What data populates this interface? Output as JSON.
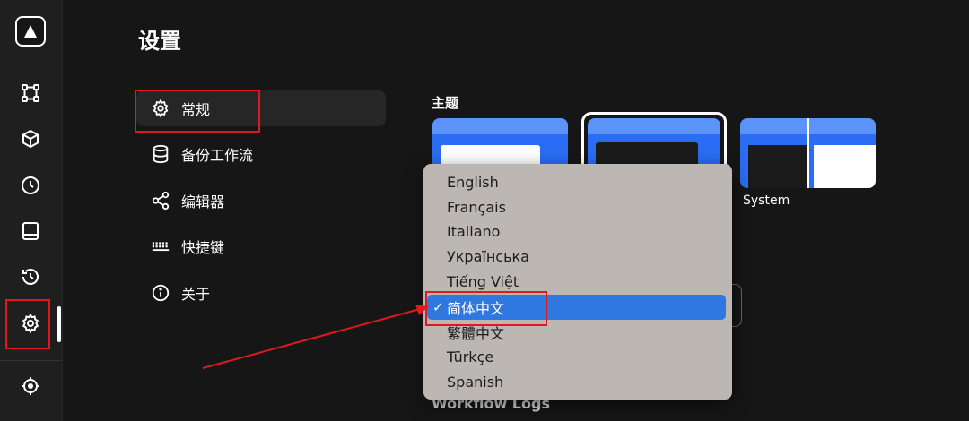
{
  "app": {
    "page_title": "设置"
  },
  "rail": {
    "icons": [
      "logo-icon",
      "workflow-icon",
      "package-icon",
      "clock-icon",
      "panel-icon",
      "history-icon",
      "gear-icon",
      "crosshair-icon"
    ]
  },
  "nav": {
    "items": [
      {
        "label": "常规",
        "icon": "gear-icon",
        "active": true
      },
      {
        "label": "备份工作流",
        "icon": "database-icon",
        "active": false
      },
      {
        "label": "编辑器",
        "icon": "share-nodes-icon",
        "active": false
      },
      {
        "label": "快捷键",
        "icon": "keyboard-icon",
        "active": false
      },
      {
        "label": "关于",
        "icon": "info-icon",
        "active": false
      }
    ]
  },
  "theme": {
    "title": "主题",
    "options": [
      "Light",
      "Dark",
      "System"
    ],
    "selected": "Dark",
    "system_label": "System"
  },
  "language_menu": {
    "options": [
      "English",
      "Français",
      "Italiano",
      "Українська",
      "Tiếng Việt",
      "简体中文",
      "繁體中文",
      "Türkçe",
      "Spanish"
    ],
    "selected": "简体中文",
    "check_mark": "✓"
  },
  "sections": {
    "workflow_logs": "Workflow Logs"
  },
  "colors": {
    "background": "#161616",
    "accent": "#2f78e0",
    "annotation_red": "#e0191f",
    "theme_blue": "#2a6df4"
  }
}
